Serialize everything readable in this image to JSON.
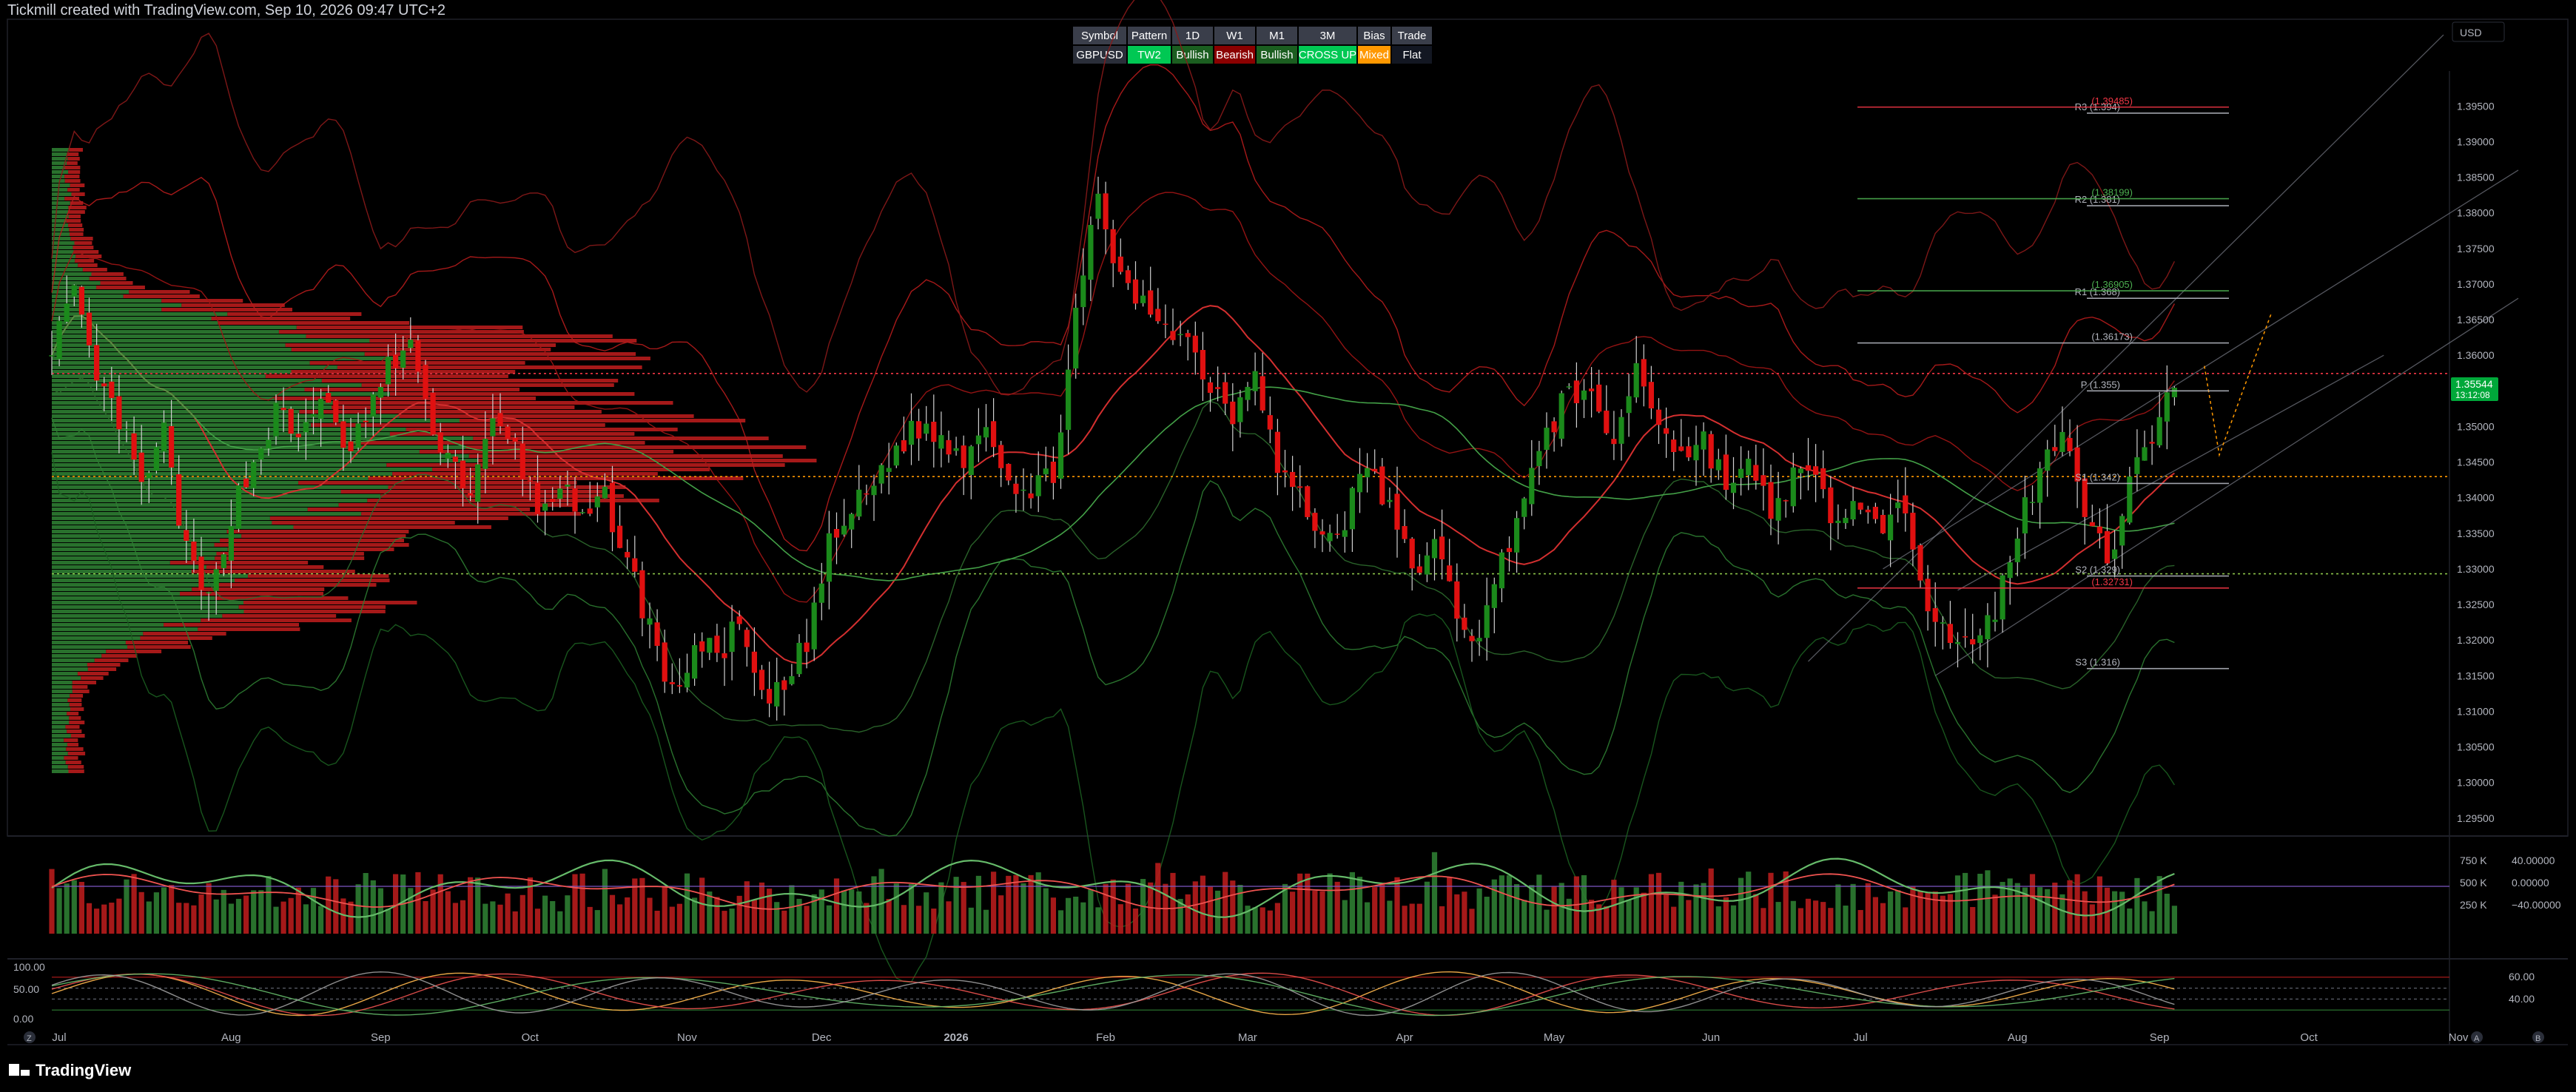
{
  "header": {
    "title": "Tickmill created with TradingView.com, Sep 10, 2026 09:47 UTC+2",
    "currency_label": "USD",
    "footer_logo_text": "TradingView",
    "footer_left_badge": "Z",
    "footer_right_icons": [
      "A",
      "B"
    ]
  },
  "status_table": {
    "headers": [
      "Symbol",
      "Pattern",
      "1D",
      "W1",
      "M1",
      "3M",
      "Bias",
      "Trade"
    ],
    "values": [
      {
        "text": "GBPUSD",
        "color": "#2a2e39"
      },
      {
        "text": "TW2",
        "color": "#00c853"
      },
      {
        "text": "Bullish",
        "color": "#1b5e20"
      },
      {
        "text": "Bearish",
        "color": "#8b0000"
      },
      {
        "text": "Bullish",
        "color": "#1b5e20"
      },
      {
        "text": "CROSS UP",
        "color": "#00c853"
      },
      {
        "text": "Mixed",
        "color": "#ff9800"
      },
      {
        "text": "Flat",
        "color": "#131722"
      }
    ]
  },
  "price_badge": {
    "price": "1.35544",
    "countdown": "13:12:08",
    "color": "#00a83a"
  },
  "chart_data": [
    {
      "type": "candlestick",
      "symbol": "GBPUSD",
      "timeframe": "1D",
      "title": "",
      "y_axis_labels": [
        "1.29500",
        "1.30000",
        "1.30500",
        "1.31000",
        "1.31500",
        "1.32000",
        "1.32500",
        "1.33000",
        "1.33500",
        "1.34000",
        "1.34500",
        "1.35000",
        "1.35500",
        "1.36000",
        "1.36500",
        "1.37000",
        "1.37500",
        "1.38000",
        "1.38500",
        "1.39000",
        "1.39500"
      ],
      "ylim": [
        1.293,
        1.3995
      ],
      "x_labels": [
        "Jul",
        "Aug",
        "Sep",
        "Oct",
        "Nov",
        "Dec",
        "2026",
        "Feb",
        "Mar",
        "Apr",
        "May",
        "Jun",
        "Jul",
        "Aug",
        "Sep",
        "Oct",
        "Nov"
      ],
      "x_label_positions": [
        0,
        23,
        43,
        63,
        84,
        102,
        120,
        140,
        159,
        180,
        200,
        221,
        241,
        262,
        281,
        301,
        321
      ],
      "last_bar_index": 284,
      "close_path": [
        [
          0,
          1.362
        ],
        [
          3,
          1.368
        ],
        [
          6,
          1.356
        ],
        [
          9,
          1.351
        ],
        [
          12,
          1.341
        ],
        [
          15,
          1.349
        ],
        [
          18,
          1.332
        ],
        [
          21,
          1.325
        ],
        [
          24,
          1.338
        ],
        [
          27,
          1.345
        ],
        [
          30,
          1.352
        ],
        [
          33,
          1.348
        ],
        [
          36,
          1.355
        ],
        [
          39,
          1.346
        ],
        [
          42,
          1.351
        ],
        [
          45,
          1.358
        ],
        [
          48,
          1.362
        ],
        [
          50,
          1.352
        ],
        [
          53,
          1.346
        ],
        [
          56,
          1.341
        ],
        [
          59,
          1.35
        ],
        [
          62,
          1.347
        ],
        [
          65,
          1.338
        ],
        [
          68,
          1.342
        ],
        [
          71,
          1.336
        ],
        [
          74,
          1.34
        ],
        [
          77,
          1.331
        ],
        [
          80,
          1.322
        ],
        [
          83,
          1.312
        ],
        [
          86,
          1.319
        ],
        [
          89,
          1.318
        ],
        [
          92,
          1.322
        ],
        [
          95,
          1.311
        ],
        [
          98,
          1.313
        ],
        [
          101,
          1.32
        ],
        [
          104,
          1.333
        ],
        [
          107,
          1.338
        ],
        [
          110,
          1.342
        ],
        [
          113,
          1.347
        ],
        [
          116,
          1.35
        ],
        [
          119,
          1.348
        ],
        [
          122,
          1.346
        ],
        [
          125,
          1.351
        ],
        [
          128,
          1.343
        ],
        [
          131,
          1.34
        ],
        [
          134,
          1.344
        ],
        [
          137,
          1.365
        ],
        [
          140,
          1.382
        ],
        [
          143,
          1.37
        ],
        [
          146,
          1.367
        ],
        [
          149,
          1.365
        ],
        [
          152,
          1.362
        ],
        [
          155,
          1.356
        ],
        [
          158,
          1.352
        ],
        [
          161,
          1.359
        ],
        [
          164,
          1.344
        ],
        [
          167,
          1.34
        ],
        [
          170,
          1.334
        ],
        [
          173,
          1.337
        ],
        [
          176,
          1.345
        ],
        [
          179,
          1.338
        ],
        [
          182,
          1.33
        ],
        [
          185,
          1.333
        ],
        [
          188,
          1.324
        ],
        [
          191,
          1.32
        ],
        [
          194,
          1.331
        ],
        [
          197,
          1.341
        ],
        [
          200,
          1.348
        ],
        [
          203,
          1.356
        ],
        [
          206,
          1.353
        ],
        [
          209,
          1.348
        ],
        [
          212,
          1.358
        ],
        [
          215,
          1.351
        ],
        [
          218,
          1.346
        ],
        [
          221,
          1.348
        ],
        [
          224,
          1.342
        ],
        [
          227,
          1.344
        ],
        [
          230,
          1.338
        ],
        [
          233,
          1.343
        ],
        [
          236,
          1.342
        ],
        [
          239,
          1.336
        ],
        [
          242,
          1.34
        ],
        [
          245,
          1.334
        ],
        [
          248,
          1.339
        ],
        [
          251,
          1.326
        ],
        [
          254,
          1.321
        ],
        [
          257,
          1.318
        ],
        [
          260,
          1.324
        ],
        [
          263,
          1.336
        ],
        [
          266,
          1.343
        ],
        [
          269,
          1.351
        ],
        [
          272,
          1.339
        ],
        [
          275,
          1.33
        ],
        [
          278,
          1.343
        ],
        [
          281,
          1.349
        ],
        [
          284,
          1.356
        ],
        [
          287,
          1.355
        ],
        [
          290,
          1.351
        ],
        [
          293,
          1.364
        ],
        [
          296,
          1.361
        ],
        [
          299,
          1.358
        ],
        [
          302,
          1.354
        ],
        [
          305,
          1.357
        ],
        [
          308,
          1.356
        ]
      ],
      "last_price": 1.35544,
      "pivot_levels": [
        {
          "label": "R3 (1.394)",
          "value": 1.394,
          "color": "#b2b5be"
        },
        {
          "label": "(1.39485)",
          "value": 1.39485,
          "color": "#f23645"
        },
        {
          "label": "R2 (1.381)",
          "value": 1.381,
          "color": "#b2b5be"
        },
        {
          "label": "(1.38199)",
          "value": 1.38199,
          "color": "#4caf50"
        },
        {
          "label": "R1 (1.368)",
          "value": 1.368,
          "color": "#b2b5be"
        },
        {
          "label": "(1.36905)",
          "value": 1.36905,
          "color": "#4caf50"
        },
        {
          "label": "(1.36173)",
          "value": 1.36173,
          "color": "#b2b5be"
        },
        {
          "label": "P (1.355)",
          "value": 1.355,
          "color": "#b2b5be"
        },
        {
          "label": "S1 (1.342)",
          "value": 1.342,
          "color": "#b2b5be"
        },
        {
          "label": "S2 (1.329)",
          "value": 1.329,
          "color": "#b2b5be"
        },
        {
          "label": "(1.32731)",
          "value": 1.32731,
          "color": "#f23645"
        },
        {
          "label": "S3 (1.316)",
          "value": 1.316,
          "color": "#b2b5be"
        }
      ],
      "horizontal_lines": [
        {
          "value": 1.35744,
          "color": "#f23645",
          "style": "dotted"
        },
        {
          "value": 1.34296,
          "color": "#ff9800",
          "style": "dotted"
        },
        {
          "value": 1.32931,
          "color": "#8bc34a",
          "style": "dotted"
        }
      ],
      "volume_profile": {
        "side": "left",
        "bull_color": "#2e7d32",
        "bear_color": "#b71c1c"
      },
      "grid": false
    },
    {
      "type": "bar+line",
      "name": "",
      "y_axis_labels_left": [
        "750 K",
        "500 K",
        "250 K"
      ],
      "y_axis_labels_right": [
        "40.00000",
        "0.00000",
        "−40.00000"
      ],
      "bull_color": "#2e7d32",
      "bear_color": "#b71c1c"
    },
    {
      "type": "line",
      "name": "",
      "y_axis_labels_left": [
        "100.00",
        "50.00",
        "0.00"
      ],
      "y_axis_labels_right": [
        "60.00",
        "40.00"
      ],
      "ylim": [
        0,
        100
      ],
      "levels": [
        80,
        60,
        40,
        20
      ]
    }
  ]
}
